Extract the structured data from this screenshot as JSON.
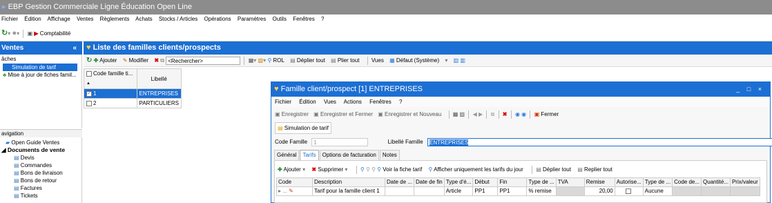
{
  "app": {
    "title": "EBP Gestion Commerciale Ligne Éducation Open Line"
  },
  "menu": [
    "Fichier",
    "Édition",
    "Affichage",
    "Ventes",
    "Règlements",
    "Achats",
    "Stocks / Articles",
    "Opérations",
    "Paramètres",
    "Outils",
    "Fenêtres",
    "?"
  ],
  "toolbar": {
    "comptabilite": "Comptabilité"
  },
  "sidebar": {
    "title": "Ventes",
    "collapse": "«",
    "section": "âches",
    "items": [
      "Simulation de tarif",
      "Mise à jour de fiches famil..."
    ],
    "nav_title": "avigation",
    "nav_items": [
      {
        "label": "Open Guide Ventes",
        "level": 1
      },
      {
        "label": "Documents de vente",
        "level": 0
      },
      {
        "label": "Devis",
        "level": 2
      },
      {
        "label": "Commandes",
        "level": 2
      },
      {
        "label": "Bons de livraison",
        "level": 2
      },
      {
        "label": "Bons de retour",
        "level": 2
      },
      {
        "label": "Factures",
        "level": 2
      },
      {
        "label": "Tickets",
        "level": 2
      }
    ]
  },
  "main": {
    "title": "Liste des familles clients/prospects",
    "toolbar": {
      "ajouter": "Ajouter",
      "modifier": "Modifier",
      "search_placeholder": "<Rechercher>",
      "rol": "ROL",
      "deplier": "Déplier tout",
      "plier": "Plier tout",
      "vues": "Vues",
      "defaut": "Défaut (Système)"
    },
    "columns": [
      "Code famille ti...",
      "Libellé"
    ],
    "rows": [
      {
        "code": "1",
        "label": "ENTREPRISES",
        "checked": true
      },
      {
        "code": "2",
        "label": "PARTICULIERS",
        "checked": false
      }
    ]
  },
  "dialog": {
    "title": "Famille client/prospect [1] ENTREPRISES",
    "controls": "_ □ ×",
    "menu": [
      "Fichier",
      "Édition",
      "Vues",
      "Actions",
      "Fenêtres",
      "?"
    ],
    "toolbar": {
      "enregistrer": "Enregistrer",
      "enregistrer_fermer": "Enregistrer et Fermer",
      "enregistrer_nouveau": "Enregistrer et Nouveau",
      "fermer": "Fermer"
    },
    "simulation": "Simulation de tarif",
    "code_label": "Code Famille",
    "code_value": "1",
    "libelle_label": "Libellé Famille",
    "libelle_value": "ENTREPRISES",
    "tabs": [
      "Général",
      "Tarifs",
      "Options de facturation",
      "Notes"
    ],
    "active_tab": "Tarifs",
    "tarif_toolbar": {
      "ajouter": "Ajouter",
      "supprimer": "Supprimer",
      "voir": "Voir la fiche tarif",
      "afficher": "Afficher uniquement les tarifs du jour",
      "deplier": "Déplier tout",
      "replier": "Replier tout"
    },
    "grid": {
      "headers": [
        "Code",
        "Description",
        "Date de ...",
        "Date de fin",
        "Type d'é...",
        "Début",
        "Fin",
        "Type de ...",
        "TVA",
        "Remise",
        "Autorise...",
        "Type de ...",
        "Code de...",
        "Quantité...",
        "Prix/valeur"
      ],
      "row": [
        "▸ ...",
        "Tarif pour la famille client 1",
        "",
        "",
        "Article",
        "PP1",
        "PP1",
        "% remise",
        "",
        "20,00",
        "",
        "Aucune",
        "",
        "",
        ""
      ]
    }
  }
}
